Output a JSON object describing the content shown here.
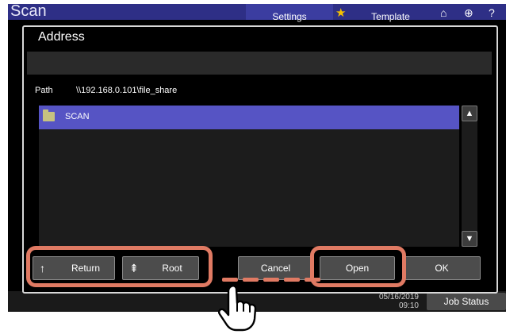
{
  "app": {
    "title": "Scan"
  },
  "top_bar": {
    "settings_label": "Settings",
    "template_label": "Template",
    "icons": [
      "star-icon",
      "home-icon",
      "globe-icon",
      "help-icon"
    ]
  },
  "dialog": {
    "title": "Address",
    "address_value": "",
    "path_label": "Path",
    "path_value": "\\\\192.168.0.101\\file_share",
    "list": {
      "items": [
        {
          "label": "SCAN",
          "icon": "folder-icon",
          "selected": true
        }
      ]
    },
    "buttons": {
      "return_label": "Return",
      "root_label": "Root",
      "cancel_label": "Cancel",
      "open_label": "Open",
      "ok_label": "OK"
    }
  },
  "status_bar": {
    "date": "05/16/2019",
    "time": "09:10",
    "job_status_label": "Job Status"
  },
  "colors": {
    "accent": "#5654c4",
    "highlight": "#e07a63",
    "topbar": "#2e2f86"
  }
}
